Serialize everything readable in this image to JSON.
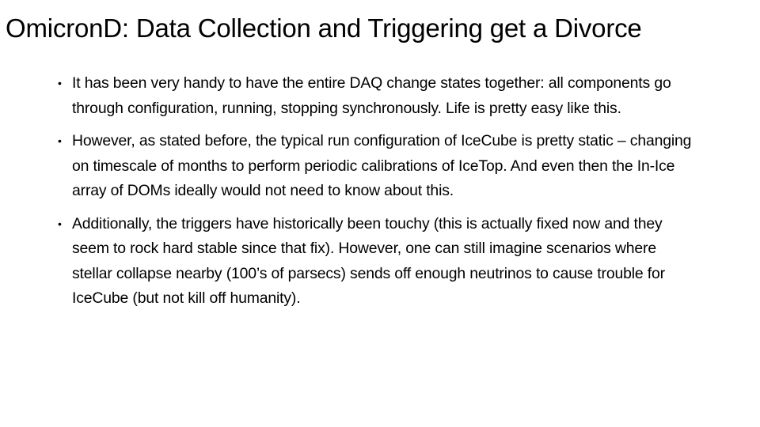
{
  "slide": {
    "title": "OmicronD: Data Collection and Triggering get a Divorce",
    "bullets": [
      {
        "marker": "•",
        "text": "It has been very handy to have the entire DAQ change states together: all components go through configuration, running, stopping synchronously.  Life is pretty easy like this."
      },
      {
        "marker": "•",
        "text": "However, as stated before, the typical run configuration of IceCube is pretty static – changing on timescale of months to perform periodic calibrations of IceTop.  And even then the In-Ice array of DOMs ideally would not need to know about this."
      },
      {
        "marker": "•",
        "text": "Additionally, the triggers have historically been touchy (this is actually fixed now and they seem to rock hard stable since that fix).  However, one can still imagine scenarios where stellar collapse nearby (100’s of parsecs) sends off enough neutrinos to cause trouble for IceCube (but not kill off humanity)."
      }
    ]
  }
}
